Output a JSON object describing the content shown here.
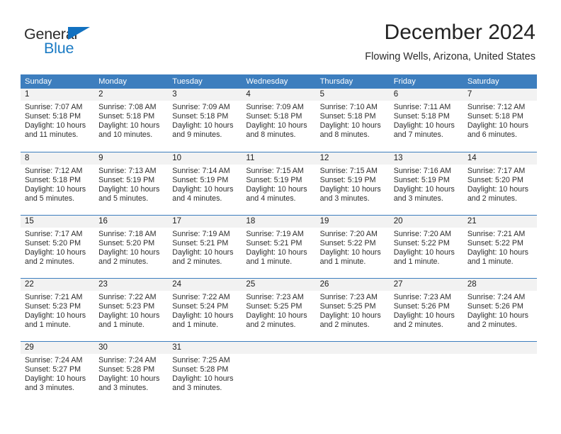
{
  "logo": {
    "word_one": "General",
    "word_two": "Blue",
    "triangle_color": "#1271c0",
    "blue_color": "#1b7bc4"
  },
  "header": {
    "title": "December 2024",
    "subtitle": "Flowing Wells, Arizona, United States",
    "accent_color": "#3d7ebe",
    "band_color": "#f2f2f2"
  },
  "weekdays": [
    "Sunday",
    "Monday",
    "Tuesday",
    "Wednesday",
    "Thursday",
    "Friday",
    "Saturday"
  ],
  "weeks": [
    [
      {
        "day": "1",
        "sunrise": "Sunrise: 7:07 AM",
        "sunset": "Sunset: 5:18 PM",
        "daylight_1": "Daylight: 10 hours",
        "daylight_2": "and 11 minutes."
      },
      {
        "day": "2",
        "sunrise": "Sunrise: 7:08 AM",
        "sunset": "Sunset: 5:18 PM",
        "daylight_1": "Daylight: 10 hours",
        "daylight_2": "and 10 minutes."
      },
      {
        "day": "3",
        "sunrise": "Sunrise: 7:09 AM",
        "sunset": "Sunset: 5:18 PM",
        "daylight_1": "Daylight: 10 hours",
        "daylight_2": "and 9 minutes."
      },
      {
        "day": "4",
        "sunrise": "Sunrise: 7:09 AM",
        "sunset": "Sunset: 5:18 PM",
        "daylight_1": "Daylight: 10 hours",
        "daylight_2": "and 8 minutes."
      },
      {
        "day": "5",
        "sunrise": "Sunrise: 7:10 AM",
        "sunset": "Sunset: 5:18 PM",
        "daylight_1": "Daylight: 10 hours",
        "daylight_2": "and 8 minutes."
      },
      {
        "day": "6",
        "sunrise": "Sunrise: 7:11 AM",
        "sunset": "Sunset: 5:18 PM",
        "daylight_1": "Daylight: 10 hours",
        "daylight_2": "and 7 minutes."
      },
      {
        "day": "7",
        "sunrise": "Sunrise: 7:12 AM",
        "sunset": "Sunset: 5:18 PM",
        "daylight_1": "Daylight: 10 hours",
        "daylight_2": "and 6 minutes."
      }
    ],
    [
      {
        "day": "8",
        "sunrise": "Sunrise: 7:12 AM",
        "sunset": "Sunset: 5:18 PM",
        "daylight_1": "Daylight: 10 hours",
        "daylight_2": "and 5 minutes."
      },
      {
        "day": "9",
        "sunrise": "Sunrise: 7:13 AM",
        "sunset": "Sunset: 5:19 PM",
        "daylight_1": "Daylight: 10 hours",
        "daylight_2": "and 5 minutes."
      },
      {
        "day": "10",
        "sunrise": "Sunrise: 7:14 AM",
        "sunset": "Sunset: 5:19 PM",
        "daylight_1": "Daylight: 10 hours",
        "daylight_2": "and 4 minutes."
      },
      {
        "day": "11",
        "sunrise": "Sunrise: 7:15 AM",
        "sunset": "Sunset: 5:19 PM",
        "daylight_1": "Daylight: 10 hours",
        "daylight_2": "and 4 minutes."
      },
      {
        "day": "12",
        "sunrise": "Sunrise: 7:15 AM",
        "sunset": "Sunset: 5:19 PM",
        "daylight_1": "Daylight: 10 hours",
        "daylight_2": "and 3 minutes."
      },
      {
        "day": "13",
        "sunrise": "Sunrise: 7:16 AM",
        "sunset": "Sunset: 5:19 PM",
        "daylight_1": "Daylight: 10 hours",
        "daylight_2": "and 3 minutes."
      },
      {
        "day": "14",
        "sunrise": "Sunrise: 7:17 AM",
        "sunset": "Sunset: 5:20 PM",
        "daylight_1": "Daylight: 10 hours",
        "daylight_2": "and 2 minutes."
      }
    ],
    [
      {
        "day": "15",
        "sunrise": "Sunrise: 7:17 AM",
        "sunset": "Sunset: 5:20 PM",
        "daylight_1": "Daylight: 10 hours",
        "daylight_2": "and 2 minutes."
      },
      {
        "day": "16",
        "sunrise": "Sunrise: 7:18 AM",
        "sunset": "Sunset: 5:20 PM",
        "daylight_1": "Daylight: 10 hours",
        "daylight_2": "and 2 minutes."
      },
      {
        "day": "17",
        "sunrise": "Sunrise: 7:19 AM",
        "sunset": "Sunset: 5:21 PM",
        "daylight_1": "Daylight: 10 hours",
        "daylight_2": "and 2 minutes."
      },
      {
        "day": "18",
        "sunrise": "Sunrise: 7:19 AM",
        "sunset": "Sunset: 5:21 PM",
        "daylight_1": "Daylight: 10 hours",
        "daylight_2": "and 1 minute."
      },
      {
        "day": "19",
        "sunrise": "Sunrise: 7:20 AM",
        "sunset": "Sunset: 5:22 PM",
        "daylight_1": "Daylight: 10 hours",
        "daylight_2": "and 1 minute."
      },
      {
        "day": "20",
        "sunrise": "Sunrise: 7:20 AM",
        "sunset": "Sunset: 5:22 PM",
        "daylight_1": "Daylight: 10 hours",
        "daylight_2": "and 1 minute."
      },
      {
        "day": "21",
        "sunrise": "Sunrise: 7:21 AM",
        "sunset": "Sunset: 5:22 PM",
        "daylight_1": "Daylight: 10 hours",
        "daylight_2": "and 1 minute."
      }
    ],
    [
      {
        "day": "22",
        "sunrise": "Sunrise: 7:21 AM",
        "sunset": "Sunset: 5:23 PM",
        "daylight_1": "Daylight: 10 hours",
        "daylight_2": "and 1 minute."
      },
      {
        "day": "23",
        "sunrise": "Sunrise: 7:22 AM",
        "sunset": "Sunset: 5:23 PM",
        "daylight_1": "Daylight: 10 hours",
        "daylight_2": "and 1 minute."
      },
      {
        "day": "24",
        "sunrise": "Sunrise: 7:22 AM",
        "sunset": "Sunset: 5:24 PM",
        "daylight_1": "Daylight: 10 hours",
        "daylight_2": "and 1 minute."
      },
      {
        "day": "25",
        "sunrise": "Sunrise: 7:23 AM",
        "sunset": "Sunset: 5:25 PM",
        "daylight_1": "Daylight: 10 hours",
        "daylight_2": "and 2 minutes."
      },
      {
        "day": "26",
        "sunrise": "Sunrise: 7:23 AM",
        "sunset": "Sunset: 5:25 PM",
        "daylight_1": "Daylight: 10 hours",
        "daylight_2": "and 2 minutes."
      },
      {
        "day": "27",
        "sunrise": "Sunrise: 7:23 AM",
        "sunset": "Sunset: 5:26 PM",
        "daylight_1": "Daylight: 10 hours",
        "daylight_2": "and 2 minutes."
      },
      {
        "day": "28",
        "sunrise": "Sunrise: 7:24 AM",
        "sunset": "Sunset: 5:26 PM",
        "daylight_1": "Daylight: 10 hours",
        "daylight_2": "and 2 minutes."
      }
    ],
    [
      {
        "day": "29",
        "sunrise": "Sunrise: 7:24 AM",
        "sunset": "Sunset: 5:27 PM",
        "daylight_1": "Daylight: 10 hours",
        "daylight_2": "and 3 minutes."
      },
      {
        "day": "30",
        "sunrise": "Sunrise: 7:24 AM",
        "sunset": "Sunset: 5:28 PM",
        "daylight_1": "Daylight: 10 hours",
        "daylight_2": "and 3 minutes."
      },
      {
        "day": "31",
        "sunrise": "Sunrise: 7:25 AM",
        "sunset": "Sunset: 5:28 PM",
        "daylight_1": "Daylight: 10 hours",
        "daylight_2": "and 3 minutes."
      },
      {
        "day": "",
        "sunrise": "",
        "sunset": "",
        "daylight_1": "",
        "daylight_2": ""
      },
      {
        "day": "",
        "sunrise": "",
        "sunset": "",
        "daylight_1": "",
        "daylight_2": ""
      },
      {
        "day": "",
        "sunrise": "",
        "sunset": "",
        "daylight_1": "",
        "daylight_2": ""
      },
      {
        "day": "",
        "sunrise": "",
        "sunset": "",
        "daylight_1": "",
        "daylight_2": ""
      }
    ]
  ]
}
